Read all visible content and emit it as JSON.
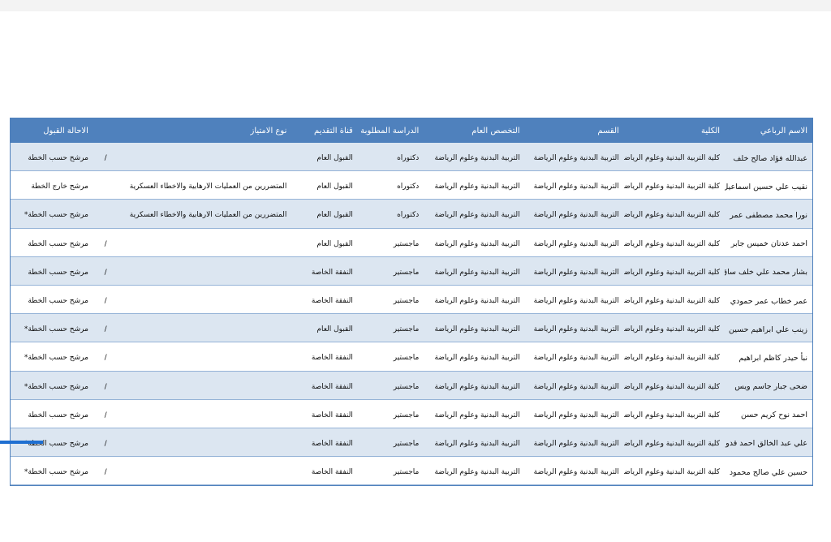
{
  "table": {
    "headers": {
      "name": "الاسم الرباعي",
      "college": "الكلية",
      "department": "القسم",
      "specialization": "التخصص العام",
      "study": "الدراسة المطلوبة",
      "channel": "قناة التقديم",
      "privilege": "نوع الامتياز",
      "status": "الاحالة القبول"
    },
    "rows": [
      {
        "name": "عبدالله فؤاد صالح خلف",
        "college": "كلية التربية البدنية وعلوم الرياضة",
        "department": "التربية البدنية وعلوم الرياضة",
        "specialization": "التربية البدنية وعلوم الرياضة",
        "study": "دكتوراه",
        "channel": "القبول العام",
        "privilege": "",
        "slash": "/",
        "status": "مرشح حسب الخطة"
      },
      {
        "name": "نقيب علي حسين اسماعيل",
        "college": "كلية التربية البدنية وعلوم الرياضة",
        "department": "التربية البدنية وعلوم الرياضة",
        "specialization": "التربية البدنية وعلوم الرياضة",
        "study": "دكتوراه",
        "channel": "القبول العام",
        "privilege": "المتضررين من العمليات الارهابية والاخطاء العسكرية",
        "slash": "",
        "status": "مرشح خارج الخطة"
      },
      {
        "name": "نورا محمد مصطفى عمر",
        "college": "كلية التربية البدنية وعلوم الرياضة",
        "department": "التربية البدنية وعلوم الرياضة",
        "specialization": "التربية البدنية وعلوم الرياضة",
        "study": "دكتوراه",
        "channel": "القبول العام",
        "privilege": "المتضررين من العمليات الارهابية والاخطاء العسكرية",
        "slash": "",
        "status": "مرشح حسب الخطة*"
      },
      {
        "name": "احمد عدنان خميس جابر",
        "college": "كلية التربية البدنية وعلوم الرياضة",
        "department": "التربية البدنية وعلوم الرياضة",
        "specialization": "التربية البدنية وعلوم الرياضة",
        "study": "ماجستير",
        "channel": "القبول العام",
        "privilege": "",
        "slash": "/",
        "status": "مرشح حسب الخطة"
      },
      {
        "name": "بشار محمد علي خلف ساق",
        "college": "كلية التربية البدنية وعلوم الرياضة",
        "department": "التربية البدنية وعلوم الرياضة",
        "specialization": "التربية البدنية وعلوم الرياضة",
        "study": "ماجستير",
        "channel": "النفقة الخاصة",
        "privilege": "",
        "slash": "/",
        "status": "مرشح حسب الخطة"
      },
      {
        "name": "عمر خطاب عمر حمودي",
        "college": "كلية التربية البدنية وعلوم الرياضة",
        "department": "التربية البدنية وعلوم الرياضة",
        "specialization": "التربية البدنية وعلوم الرياضة",
        "study": "ماجستير",
        "channel": "النفقة الخاصة",
        "privilege": "",
        "slash": "/",
        "status": "مرشح حسب الخطة"
      },
      {
        "name": "زينب علي ابراهيم حسين",
        "college": "كلية التربية البدنية وعلوم الرياضة",
        "department": "التربية البدنية وعلوم الرياضة",
        "specialization": "التربية البدنية وعلوم الرياضة",
        "study": "ماجستير",
        "channel": "القبول العام",
        "privilege": "",
        "slash": "/",
        "status": "مرشح حسب الخطة*"
      },
      {
        "name": "نبأ حيدر كاظم ابراهيم",
        "college": "كلية التربية البدنية وعلوم الرياضة",
        "department": "التربية البدنية وعلوم الرياضة",
        "specialization": "التربية البدنية وعلوم الرياضة",
        "study": "ماجستير",
        "channel": "النفقة الخاصة",
        "privilege": "",
        "slash": "/",
        "status": "مرشح حسب الخطة*"
      },
      {
        "name": "ضحى جبار جاسم ويس",
        "college": "كلية التربية البدنية وعلوم الرياضة",
        "department": "التربية البدنية وعلوم الرياضة",
        "specialization": "التربية البدنية وعلوم الرياضة",
        "study": "ماجستير",
        "channel": "النفقة الخاصة",
        "privilege": "",
        "slash": "/",
        "status": "مرشح حسب الخطة*"
      },
      {
        "name": "احمد نوح كريم حسن",
        "college": "كلية التربية البدنية وعلوم الرياضة",
        "department": "التربية البدنية وعلوم الرياضة",
        "specialization": "التربية البدنية وعلوم الرياضة",
        "study": "ماجستير",
        "channel": "النفقة الخاصة",
        "privilege": "",
        "slash": "/",
        "status": "مرشح حسب الخطة"
      },
      {
        "name": "علي عبد الخالق احمد قدو",
        "college": "كلية التربية البدنية وعلوم الرياضة",
        "department": "التربية البدنية وعلوم الرياضة",
        "specialization": "التربية البدنية وعلوم الرياضة",
        "study": "ماجستير",
        "channel": "النفقة الخاصة",
        "privilege": "",
        "slash": "/",
        "status": "مرشح حسب الخطة*"
      },
      {
        "name": "حسين علي صالح محمود",
        "college": "كلية التربية البدنية وعلوم الرياضة",
        "department": "التربية البدنية وعلوم الرياضة",
        "specialization": "التربية البدنية وعلوم الرياضة",
        "study": "ماجستير",
        "channel": "النفقة الخاصة",
        "privilege": "",
        "slash": "/",
        "status": "مرشح حسب الخطة*"
      }
    ]
  },
  "colors": {
    "header_bg": "#4f81bd",
    "band_bg": "#dce6f1",
    "border": "#95b3d7"
  }
}
